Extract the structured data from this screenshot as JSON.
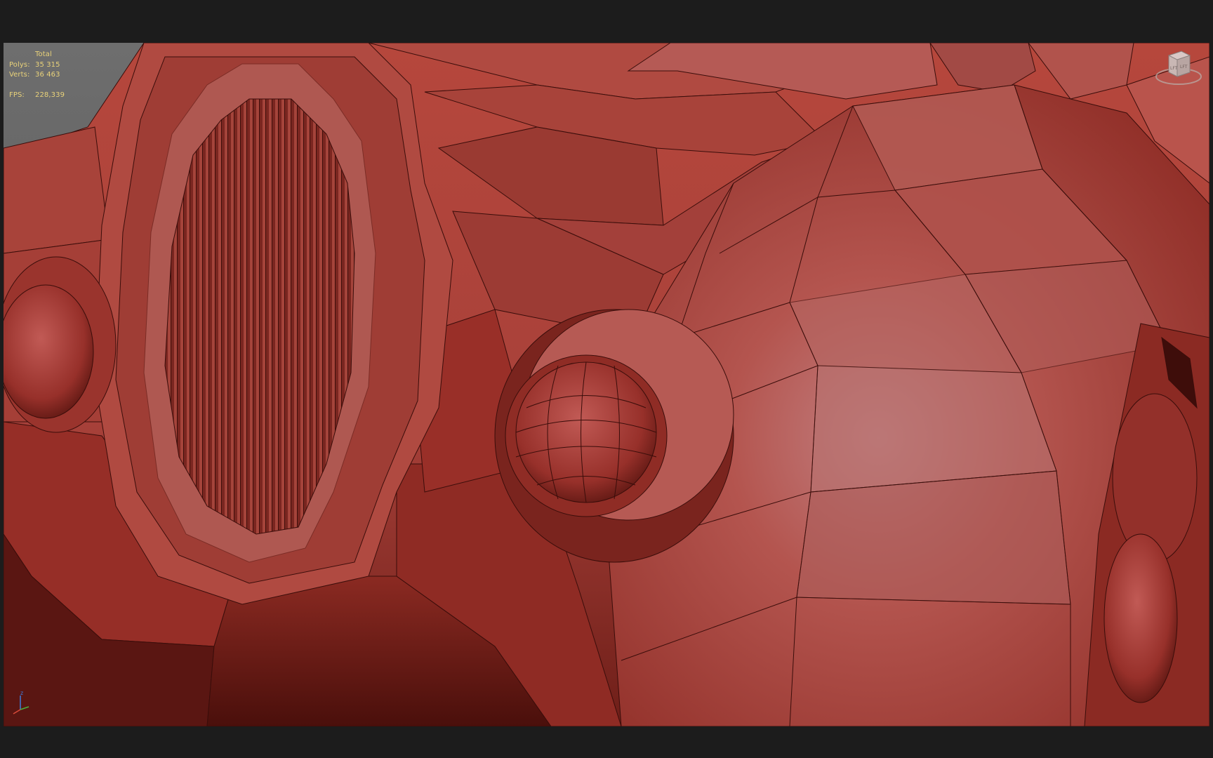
{
  "viewport": {
    "stats": {
      "header": "Total",
      "polys_label": "Polys:",
      "polys_value": "35 315",
      "verts_label": "Verts:",
      "verts_value": "36 463",
      "fps_label": "FPS:",
      "fps_value": "228,339"
    },
    "viewcube": {
      "icon": "viewcube-icon",
      "face_label": "LFT",
      "side_label": "LFT"
    },
    "axis_tripod": {
      "icon": "axis-tripod-icon",
      "z_label": "z"
    }
  },
  "colors": {
    "background": "#1c1c1c",
    "viewport": "#5f5f5f",
    "model": "#b0423a",
    "wire": "#3a0d0a",
    "stats_text": "#e9d27a"
  }
}
